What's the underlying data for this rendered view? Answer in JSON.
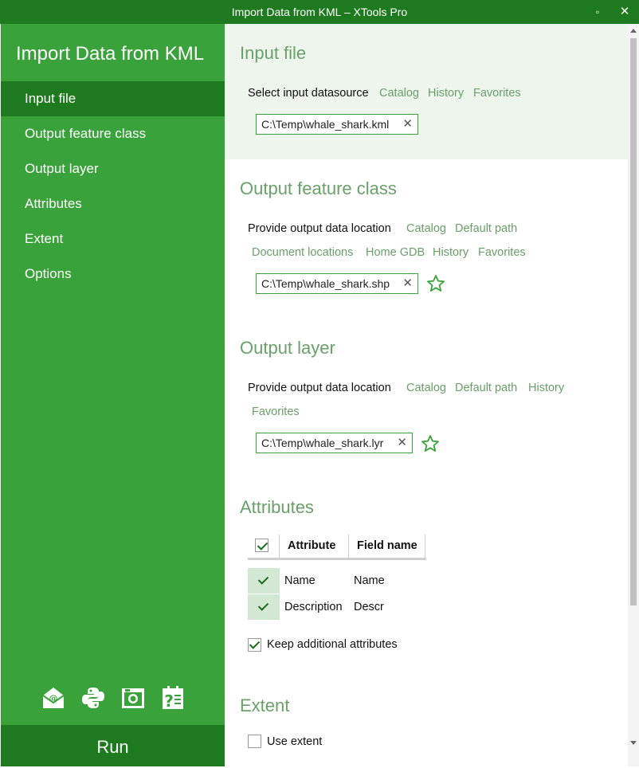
{
  "window": {
    "title": "Import Data from KML – XTools Pro",
    "maximize_glyph": "▫",
    "close_glyph": "✕"
  },
  "sidebar": {
    "title": "Import Data from KML",
    "items": [
      {
        "label": "Input file",
        "active": true
      },
      {
        "label": "Output feature class"
      },
      {
        "label": "Output layer"
      },
      {
        "label": "Attributes"
      },
      {
        "label": "Extent"
      },
      {
        "label": "Options"
      }
    ],
    "tools": [
      "email-icon",
      "python-icon",
      "screenshot-icon",
      "help-icon"
    ],
    "run_label": "Run"
  },
  "input_file": {
    "title": "Input file",
    "label": "Select input datasource",
    "links": [
      "Catalog",
      "History",
      "Favorites"
    ],
    "path": "C:\\Temp\\whale_shark.kml"
  },
  "output_fc": {
    "title": "Output feature class",
    "label": "Provide output data location",
    "links": [
      "Catalog",
      "Default path",
      "Document locations",
      "Home GDB",
      "History",
      "Favorites"
    ],
    "path": "C:\\Temp\\whale_shark.shp"
  },
  "output_layer": {
    "title": "Output layer",
    "label": "Provide output data location",
    "links": [
      "Catalog",
      "Default path",
      "History",
      "Favorites"
    ],
    "path": "C:\\Temp\\whale_shark.lyr"
  },
  "attributes": {
    "title": "Attributes",
    "columns": [
      "Attribute",
      "Field name"
    ],
    "rows": [
      {
        "attribute": "Name",
        "field": "Name",
        "checked": true
      },
      {
        "attribute": "Description",
        "field": "Descr",
        "checked": true
      }
    ],
    "keep_label": "Keep additional attributes",
    "keep_checked": true
  },
  "extent": {
    "title": "Extent",
    "use_label": "Use extent",
    "use_checked": false
  },
  "colors": {
    "dark_green": "#1e7a1e",
    "sidebar_green": "#3aa23a",
    "link_green": "#6a9f6a"
  }
}
